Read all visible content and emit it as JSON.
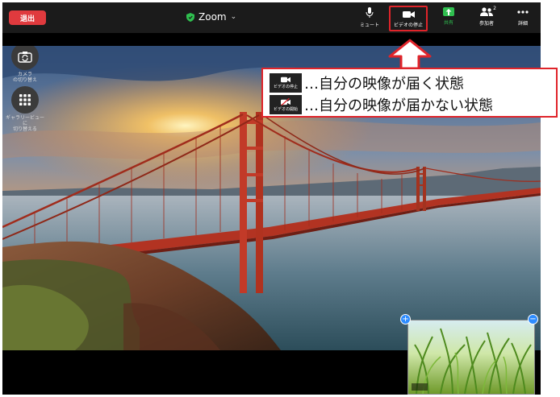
{
  "topbar": {
    "leave_label": "退出",
    "meeting_title": "Zoom",
    "buttons": [
      {
        "key": "mute",
        "label": "ミュート",
        "icon": "microphone-icon"
      },
      {
        "key": "video",
        "label": "ビデオの停止",
        "icon": "video-camera-icon"
      },
      {
        "key": "share",
        "label": "共有",
        "icon": "share-screen-icon"
      },
      {
        "key": "participants",
        "label": "参加者",
        "icon": "participants-icon",
        "count": "2"
      },
      {
        "key": "more",
        "label": "詳細",
        "icon": "more-dots-icon"
      }
    ]
  },
  "sidebar": {
    "camera_switch_label_1": "カメラ",
    "camera_switch_label_2": "の切り替え",
    "view_switch_label_1": "ギャラリービュー",
    "view_switch_label_2": "に",
    "view_switch_label_3": "切り替える"
  },
  "callout": {
    "rows": [
      {
        "icon_label": "ビデオの停止",
        "text": "…自分の映像が届く状態",
        "icon": "video-camera-icon"
      },
      {
        "icon_label": "ビデオの開始",
        "text": "…自分の映像が届かない状態",
        "icon": "video-camera-off-icon"
      }
    ]
  },
  "colors": {
    "accent_red": "#e0242a",
    "share_green": "#2fbf4f",
    "zoom_blue": "#2d8cff",
    "leave_red": "#e03a3e"
  },
  "pip": {
    "add_symbol": "+",
    "minimize_symbol": "−"
  }
}
